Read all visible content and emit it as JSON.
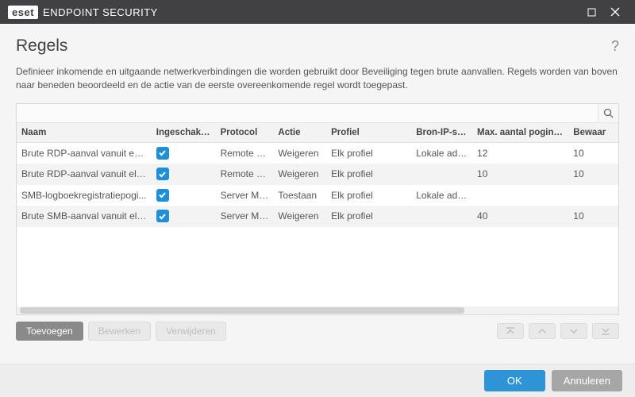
{
  "titlebar": {
    "brand_eset": "eset",
    "brand_rest": "ENDPOINT SECURITY"
  },
  "page": {
    "title": "Regels",
    "description": "Definieer inkomende en uitgaande netwerkverbindingen die worden gebruikt door Beveiliging tegen brute aanvallen. Regels worden van boven naar beneden beoordeeld en de actie van de eerste overeenkomende regel wordt toegepast."
  },
  "search": {
    "placeholder": ""
  },
  "columns": {
    "name": "Naam",
    "enabled": "Ingeschakeld",
    "protocol": "Protocol",
    "action": "Actie",
    "profile": "Profiel",
    "ipsets": "Bron-IP-sets",
    "maxattempts": "Max. aantal pogingen",
    "retention": "Bewaar"
  },
  "rows": [
    {
      "name": "Brute RDP-aanval vanuit een...",
      "enabled": true,
      "protocol": "Remote D...",
      "action": "Weigeren",
      "profile": "Elk profiel",
      "ipsets": "Lokale adre...",
      "max": "12",
      "bew": "10"
    },
    {
      "name": "Brute RDP-aanval vanuit elk ...",
      "enabled": true,
      "protocol": "Remote D...",
      "action": "Weigeren",
      "profile": "Elk profiel",
      "ipsets": "",
      "max": "10",
      "bew": "10"
    },
    {
      "name": "SMB-logboekregistratiepogi...",
      "enabled": true,
      "protocol": "Server Me...",
      "action": "Toestaan",
      "profile": "Elk profiel",
      "ipsets": "Lokale adre...",
      "max": "",
      "bew": ""
    },
    {
      "name": "Brute SMB-aanval vanuit elk...",
      "enabled": true,
      "protocol": "Server Me...",
      "action": "Weigeren",
      "profile": "Elk profiel",
      "ipsets": "",
      "max": "40",
      "bew": "10"
    }
  ],
  "buttons": {
    "add": "Toevoegen",
    "edit": "Bewerken",
    "delete": "Verwijderen",
    "ok": "OK",
    "cancel": "Annuleren"
  }
}
